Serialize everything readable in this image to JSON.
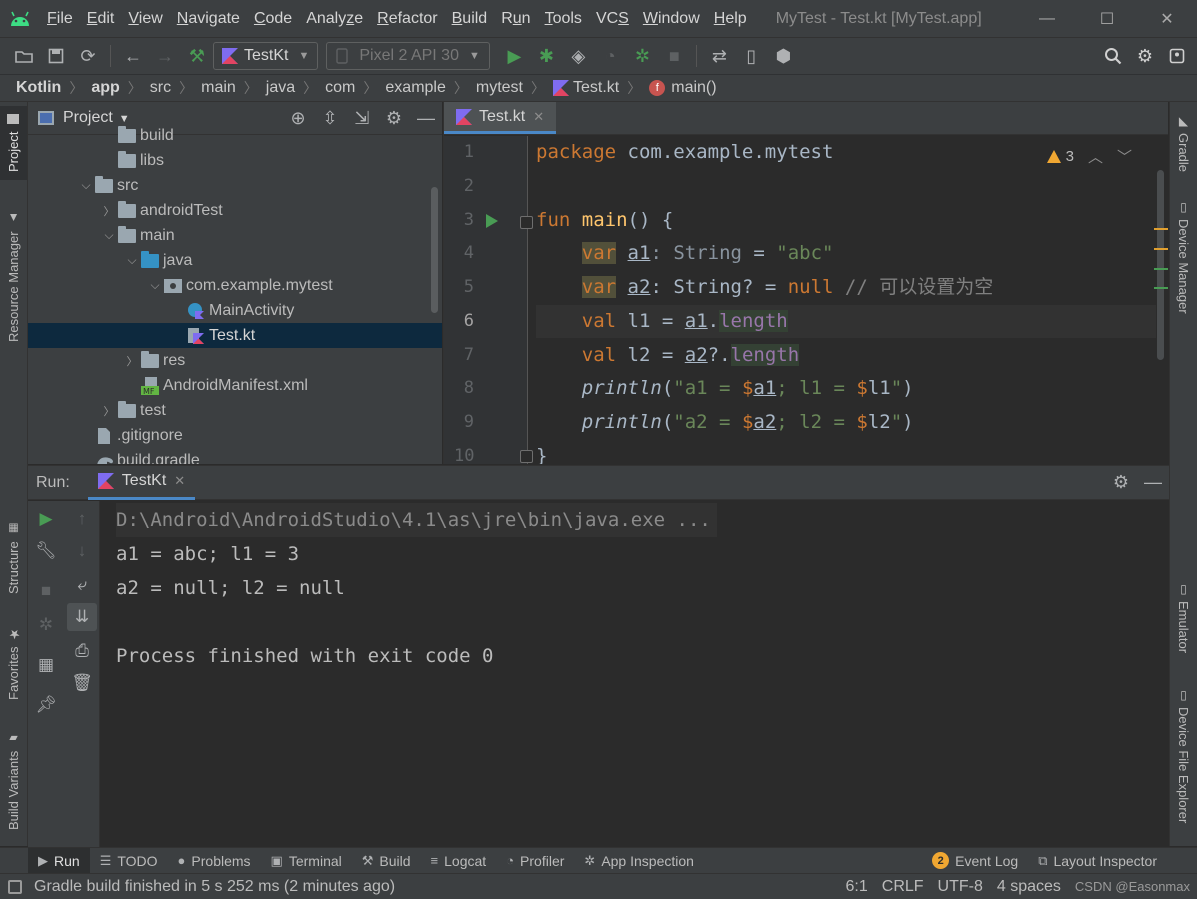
{
  "menubar": {
    "items": [
      {
        "pre": "",
        "mn": "F",
        "post": "ile"
      },
      {
        "pre": "",
        "mn": "E",
        "post": "dit"
      },
      {
        "pre": "",
        "mn": "V",
        "post": "iew"
      },
      {
        "pre": "",
        "mn": "N",
        "post": "avigate"
      },
      {
        "pre": "",
        "mn": "C",
        "post": "ode"
      },
      {
        "pre": "Analy",
        "mn": "z",
        "post": "e"
      },
      {
        "pre": "",
        "mn": "R",
        "post": "efactor"
      },
      {
        "pre": "",
        "mn": "B",
        "post": "uild"
      },
      {
        "pre": "R",
        "mn": "u",
        "post": "n"
      },
      {
        "pre": "",
        "mn": "T",
        "post": "ools"
      },
      {
        "pre": "VC",
        "mn": "S",
        "post": ""
      },
      {
        "pre": "",
        "mn": "W",
        "post": "indow"
      },
      {
        "pre": "",
        "mn": "H",
        "post": "elp"
      }
    ],
    "window_title": "MyTest - Test.kt [MyTest.app]"
  },
  "toolbar": {
    "run_config": "TestKt",
    "device": "Pixel 2 API 30"
  },
  "breadcrumb": [
    "Kotlin",
    "app",
    "src",
    "main",
    "java",
    "com",
    "example",
    "mytest",
    "Test.kt",
    "main()"
  ],
  "left_strip": {
    "project": "Project",
    "resource_manager": "Resource Manager",
    "structure": "Structure",
    "favorites": "Favorites",
    "build_variants": "Build Variants"
  },
  "right_strip": {
    "gradle": "Gradle",
    "device_manager": "Device Manager",
    "emulator": "Emulator",
    "device_file_explorer": "Device File Explorer"
  },
  "project_panel": {
    "title": "Project",
    "tree": [
      {
        "label": "build",
        "indent": 4,
        "arrow": "",
        "icon": "folder",
        "partial": true
      },
      {
        "label": "libs",
        "indent": 4,
        "arrow": "",
        "icon": "folder"
      },
      {
        "label": "src",
        "indent": 3,
        "arrow": "down",
        "icon": "folder"
      },
      {
        "label": "androidTest",
        "indent": 4,
        "arrow": "right",
        "icon": "folder"
      },
      {
        "label": "main",
        "indent": 4,
        "arrow": "down",
        "icon": "folder"
      },
      {
        "label": "java",
        "indent": 5,
        "arrow": "down",
        "icon": "folder-blue"
      },
      {
        "label": "com.example.mytest",
        "indent": 6,
        "arrow": "down",
        "icon": "package"
      },
      {
        "label": "MainActivity",
        "indent": 7,
        "arrow": "",
        "icon": "activity"
      },
      {
        "label": "Test.kt",
        "indent": 7,
        "arrow": "",
        "icon": "kotlin",
        "selected": true
      },
      {
        "label": "res",
        "indent": 5,
        "arrow": "right",
        "icon": "folder"
      },
      {
        "label": "AndroidManifest.xml",
        "indent": 5,
        "arrow": "",
        "icon": "manifest"
      },
      {
        "label": "test",
        "indent": 4,
        "arrow": "right",
        "icon": "folder"
      },
      {
        "label": ".gitignore",
        "indent": 3,
        "arrow": "",
        "icon": "file"
      },
      {
        "label": "build.gradle",
        "indent": 3,
        "arrow": "",
        "icon": "gradle"
      }
    ]
  },
  "editor": {
    "tab": "Test.kt",
    "warning_count": "3",
    "line_numbers": [
      "1",
      "2",
      "3",
      "4",
      "5",
      "6",
      "7",
      "8",
      "9",
      "10"
    ],
    "tok": {
      "package": "package",
      "pkg_name": " com.example.mytest",
      "fun": "fun",
      "main": "main",
      "parens": "() {",
      "var": "var",
      "val": "val",
      "a1": "a1",
      "a2": "a2",
      "l1": "l1",
      "l2": "l2",
      "colon_string": ": String",
      "colon_string_q": ": String?",
      "eq": " = ",
      "abc": "\"abc\"",
      "null": "null",
      "comment": " // 可以设置为空",
      "dot": ".",
      "safe": "?.",
      "length": "length",
      "println": "println",
      "open_a1": "(\"a1 = ",
      "open_a2": "(\"a2 = ",
      "dollar": "$",
      "sep_l1": "; l1 = ",
      "sep_l2": "; l2 = ",
      "close": "\")",
      "brace": "}"
    }
  },
  "run_panel": {
    "label": "Run:",
    "tab": "TestKt",
    "console": [
      "D:\\Android\\AndroidStudio\\4.1\\as\\jre\\bin\\java.exe ...",
      "a1 = abc; l1 = 3",
      "a2 = null; l2 = null",
      "",
      "Process finished with exit code 0"
    ]
  },
  "bottom_tabs": {
    "run": "Run",
    "todo": "TODO",
    "problems": "Problems",
    "terminal": "Terminal",
    "build": "Build",
    "logcat": "Logcat",
    "profiler": "Profiler",
    "app_inspection": "App Inspection",
    "event_log_count": "2",
    "event_log": "Event Log",
    "layout_inspector": "Layout Inspector"
  },
  "status_bar": {
    "message": "Gradle build finished in 5 s 252 ms (2 minutes ago)",
    "position": "6:1",
    "line_sep": "CRLF",
    "encoding": "UTF-8",
    "indent": "4 spaces",
    "watermark": "CSDN @Easonmax"
  },
  "colors": {
    "accent": "#4a88c7",
    "keyword": "#cc7832",
    "string": "#6a8759",
    "run_green": "#499c54"
  }
}
